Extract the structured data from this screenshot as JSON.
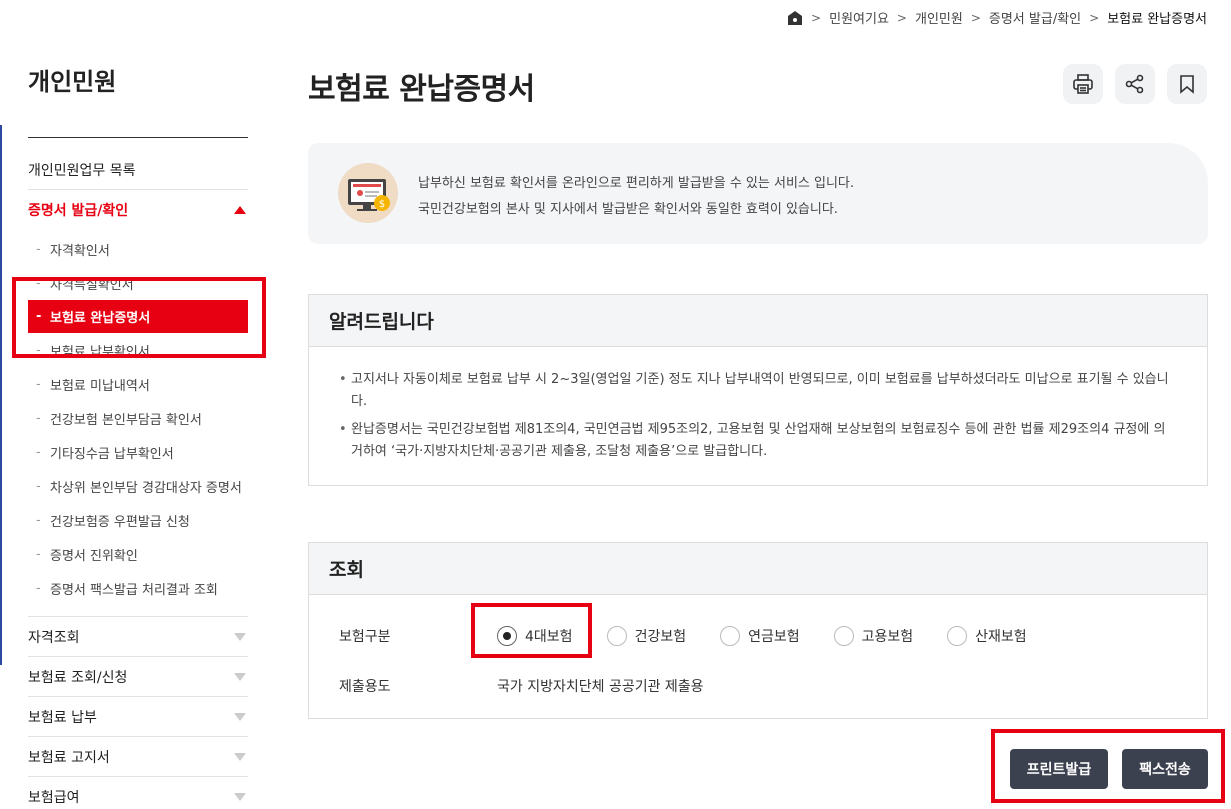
{
  "breadcrumb": {
    "items": [
      "민원여기요",
      "개인민원",
      "증명서 발급/확인",
      "보험료 완납증명서"
    ]
  },
  "sidebar": {
    "title": "개인민원",
    "top_item": "개인민원업무 목록",
    "active_section": "증명서 발급/확인",
    "sub_items": [
      "자격확인서",
      "자격득실확인서",
      "보험료 완납증명서",
      "보험료 납부확인서",
      "보험료 미납내역서",
      "건강보험 본인부담금 확인서",
      "기타징수금 납부확인서",
      "차상위 본인부담 경감대상자 증명서",
      "건강보험증 우편발급 신청",
      "증명서 진위확인",
      "증명서 팩스발급 처리결과 조회"
    ],
    "current_sub_index": 2,
    "sections": [
      "자격조회",
      "보험료 조회/신청",
      "보험료 납부",
      "보험료 고지서",
      "보험급여"
    ]
  },
  "page": {
    "title": "보험료 완납증명서"
  },
  "tools": {
    "print_icon": "print-icon",
    "share_icon": "share-icon",
    "bookmark_icon": "bookmark-icon"
  },
  "intro": {
    "line1": "납부하신 보험료 확인서를 온라인으로 편리하게 발급받을 수 있는 서비스 입니다.",
    "line2": "국민건강보험의 본사 및 지사에서 발급받은 확인서와 동일한 효력이 있습니다."
  },
  "notice": {
    "title": "알려드립니다",
    "bullets": [
      "고지서나 자동이체로 보험료 납부 시 2~3일(영업일 기준) 정도 지나 납부내역이 반영되므로, 이미 보험료를 납부하셨더라도 미납으로 표기될 수 있습니다.",
      "완납증명서는 국민건강보험법 제81조의4, 국민연금법 제95조의2, 고용보험 및 산업재해 보상보험의 보험료징수 등에 관한 법률 제29조의4 규정에 의거하여 ‘국가·지방자치단체·공공기관 제출용, 조달청 제출용’으로 발급합니다."
    ]
  },
  "query": {
    "title": "조회",
    "insurance_label": "보험구분",
    "options": [
      "4대보험",
      "건강보험",
      "연금보험",
      "고용보험",
      "산재보험"
    ],
    "selected_index": 0,
    "purpose_label": "제출용도",
    "purpose_value": "국가 지방자치단체 공공기관 제출용"
  },
  "actions": {
    "print_label": "프린트발급",
    "fax_label": "팩스전송"
  },
  "colors": {
    "accent": "#e60012",
    "button": "#3c4150",
    "panel_bg": "#f4f5f7"
  }
}
